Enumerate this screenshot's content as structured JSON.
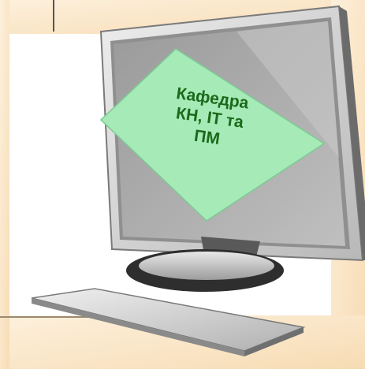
{
  "screen_sticker": {
    "lines": [
      "Кафедра",
      "КН, ІТ та",
      "ПМ"
    ]
  },
  "colors": {
    "page_background": "#fae5c6",
    "sticker_fill": "#a6eab8",
    "sticker_text": "#1a6a1a",
    "monitor_frame": "#d4d4d4",
    "monitor_screen": "#a9a9a9",
    "stand_dark": "#2e2e2e"
  },
  "icons": [
    "computer-monitor-icon",
    "keyboard-icon"
  ]
}
